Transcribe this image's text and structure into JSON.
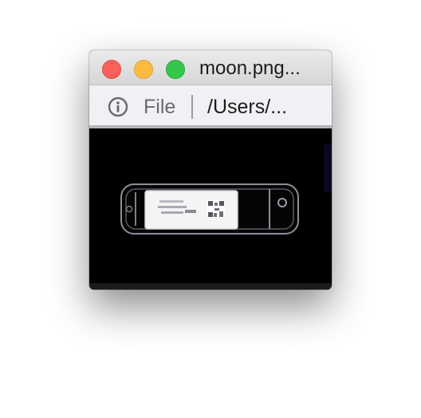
{
  "window": {
    "title": "moon.png...",
    "traffic_lights": {
      "close": "#fc605b",
      "minimize": "#fdbc40",
      "zoom": "#34c84a"
    }
  },
  "pathbar": {
    "info_icon": "info-circle-icon",
    "file_label": "File",
    "path": "/Users/..."
  },
  "preview": {
    "background": "#000000",
    "subject": "usb-drive-image"
  }
}
